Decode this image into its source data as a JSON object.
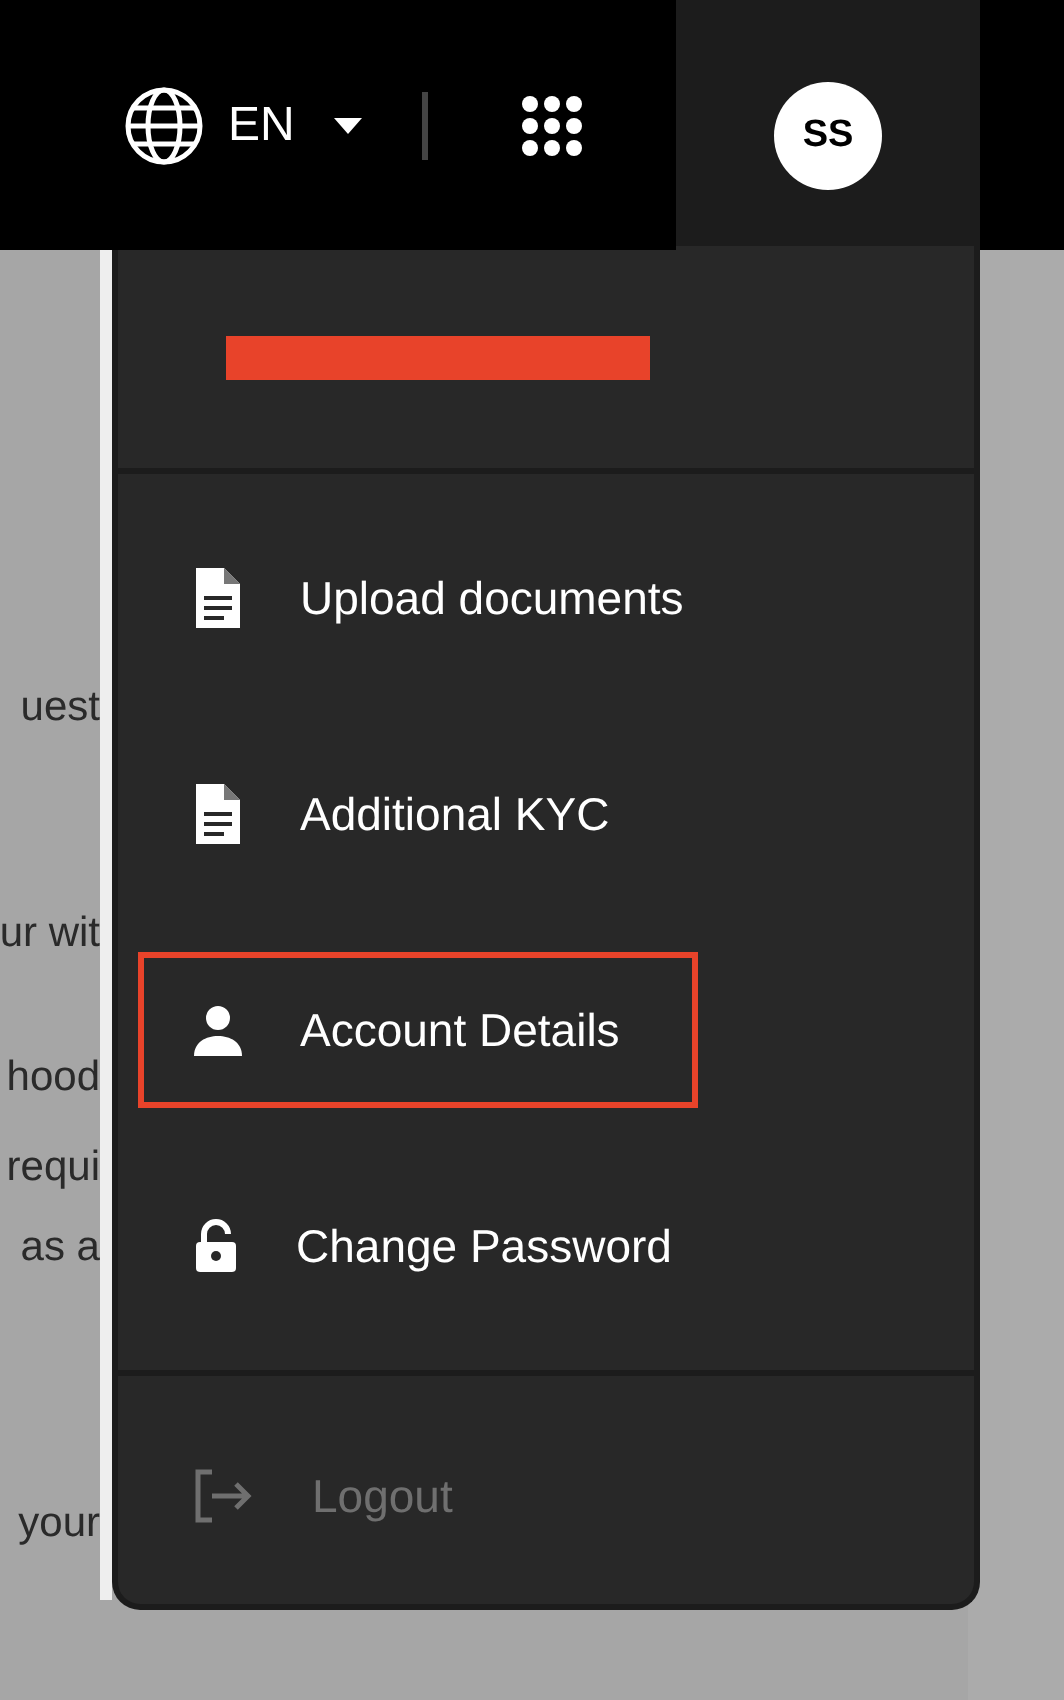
{
  "header": {
    "language": "EN",
    "avatar_initials": "SS"
  },
  "background_text": [
    {
      "text": "uest"
    },
    {
      "text": "ur wit"
    },
    {
      "text": "hood"
    },
    {
      "text": "requi"
    },
    {
      "text": "as a"
    },
    {
      "text": "your"
    }
  ],
  "menu": {
    "user_name_redacted": true,
    "items": [
      {
        "kind": "document",
        "label": "Upload documents",
        "highlighted": false,
        "disabled": false
      },
      {
        "kind": "document",
        "label": "Additional KYC",
        "highlighted": false,
        "disabled": false
      },
      {
        "kind": "person",
        "label": "Account Details",
        "highlighted": true,
        "disabled": false
      },
      {
        "kind": "lock",
        "label": "Change Password",
        "highlighted": false,
        "disabled": false
      }
    ],
    "footer_items": [
      {
        "kind": "logout",
        "label": "Logout",
        "highlighted": false,
        "disabled": true
      }
    ]
  }
}
